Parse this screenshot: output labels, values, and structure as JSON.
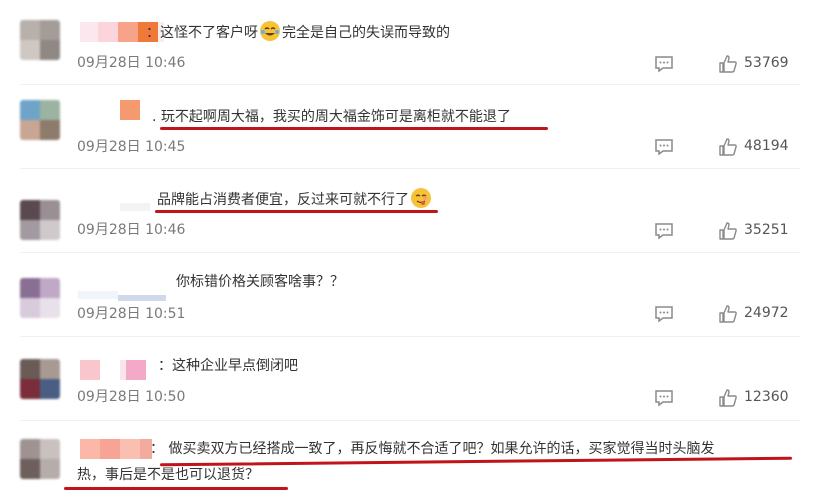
{
  "comments": [
    {
      "time": "09月28日 10:46",
      "prefix": "：",
      "text_a": "这怪不了客户呀",
      "text_b": "完全是自己的失误而导致的",
      "likes": "53769",
      "emoji": "crying-laughing-emoji",
      "underlined": false
    },
    {
      "time": "09月28日 10:45",
      "prefix": ".",
      "text": "玩不起啊周大福，我买的周大福金饰可是离柜就不能退了",
      "likes": "48194",
      "underlined": true
    },
    {
      "time": "09月28日 10:46",
      "prefix": "",
      "text": "品牌能占消费者便宜，反过来可就不行了",
      "likes": "35251",
      "emoji": "smirk-tongue-emoji",
      "underlined": true
    },
    {
      "time": "09月28日 10:51",
      "prefix": "",
      "text": "你标错价格关顾客啥事？？",
      "likes": "24972",
      "underlined": false
    },
    {
      "time": "09月28日 10:50",
      "prefix": "：",
      "text": "这种企业早点倒闭吧",
      "likes": "12360",
      "underlined": false
    },
    {
      "time": "",
      "prefix": "：",
      "text_line1": "做买卖双方已经搭成一致了，再反悔就不合适了吧？如果允许的话，买家觉得当时头脑发",
      "text_line2": "热，事后是不是也可以退货？",
      "likes": "",
      "underlined": true
    }
  ],
  "colors": {
    "underline": "#c0141a",
    "time": "#7a7a7a",
    "text": "#333333"
  }
}
